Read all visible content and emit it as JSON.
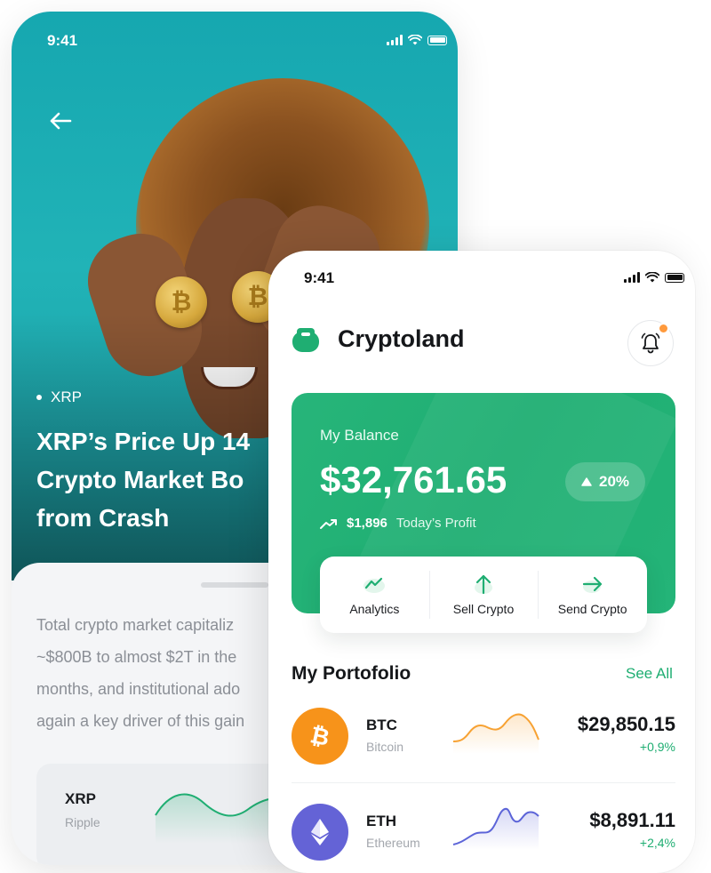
{
  "article_screen": {
    "status_time": "9:41",
    "tag": "XRP",
    "headline_lines": [
      "XRP’s Price Up 14",
      "Crypto Market Bo",
      "from Crash"
    ],
    "body_lines": [
      "Total crypto market capitaliz",
      "~$800B to almost $2T in the",
      "months, and institutional ado",
      "again a key driver of this gain"
    ],
    "mini_card": {
      "symbol": "XRP",
      "name": "Ripple"
    }
  },
  "app_screen": {
    "status_time": "9:41",
    "brand": "Cryptoland",
    "balance": {
      "label": "My Balance",
      "value": "$32,761.65",
      "change": "20%",
      "profit_value": "$1,896",
      "profit_label": "Today’s Profit"
    },
    "actions": [
      {
        "label": "Analytics",
        "icon": "analytics-icon"
      },
      {
        "label": "Sell Crypto",
        "icon": "arrow-up-icon"
      },
      {
        "label": "Send Crypto",
        "icon": "arrow-right-icon"
      }
    ],
    "portfolio": {
      "title": "My Portofolio",
      "see_all": "See All",
      "assets": [
        {
          "symbol": "BTC",
          "name": "Bitcoin",
          "price": "$29,850.15",
          "change": "+0,9%",
          "color": "#f7931a",
          "chart_color": "#f7a233"
        },
        {
          "symbol": "ETH",
          "name": "Ethereum",
          "price": "$8,891.11",
          "change": "+2,4%",
          "color": "#6463d6",
          "chart_color": "#5c64d8"
        }
      ]
    }
  },
  "colors": {
    "accent": "#1fae72",
    "hero": "#1fa9b1",
    "notification": "#ff9a3c"
  }
}
